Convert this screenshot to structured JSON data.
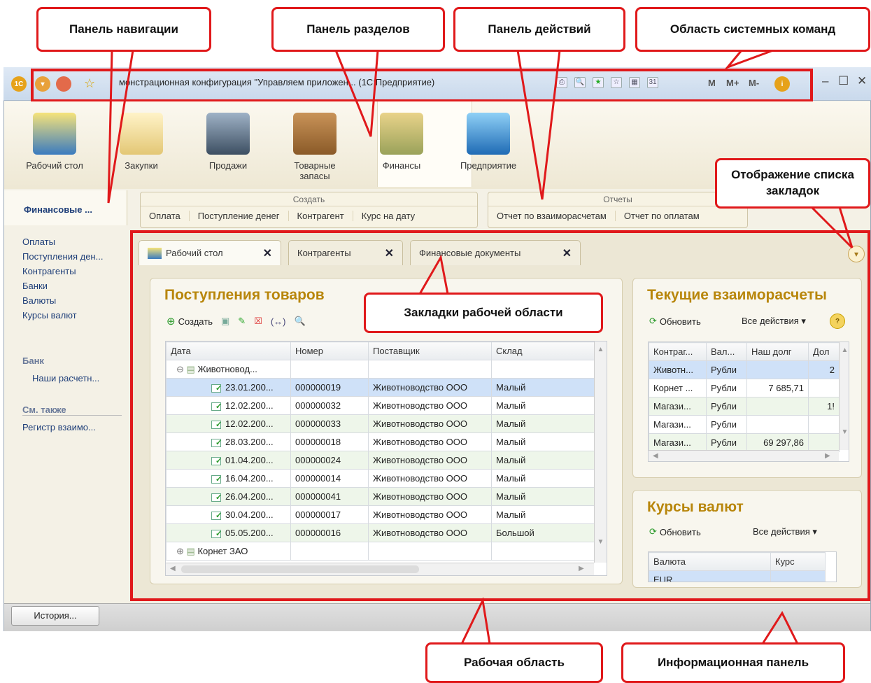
{
  "callouts": {
    "nav_panel": "Панель навигации",
    "sections_panel": "Панель разделов",
    "actions_panel": "Панель действий",
    "system_commands": "Область системных команд",
    "bookmarks_list": "Отображение списка закладок",
    "tabs_area": "Закладки рабочей области",
    "work_area": "Рабочая область",
    "info_panel": "Информационная панель"
  },
  "window": {
    "title": "монстрационная конфигурация \"Управляем  приложен... (1С:Предприятие)",
    "calc_buttons": [
      "M",
      "M+",
      "M-"
    ],
    "win_controls": [
      "–",
      "☐",
      "✕"
    ]
  },
  "sections": [
    {
      "label": "Рабочий стол",
      "icon": "desk-lamp-icon"
    },
    {
      "label": "Закупки",
      "icon": "shopping-bag-icon"
    },
    {
      "label": "Продажи",
      "icon": "cash-register-icon"
    },
    {
      "label": "Товарные запасы",
      "icon": "box-icon"
    },
    {
      "label": "Финансы",
      "icon": "coins-icon"
    },
    {
      "label": "Предприятие",
      "icon": "building-icon"
    }
  ],
  "actions": {
    "create_group": {
      "title": "Создать",
      "items": [
        "Оплата",
        "Поступление денег",
        "Контрагент",
        "Курс на дату"
      ]
    },
    "reports_group": {
      "title": "Отчеты",
      "items": [
        "Отчет по взаиморасчетам",
        "Отчет по оплатам"
      ]
    }
  },
  "nav": {
    "header": "Финансовые ...",
    "links": [
      "Оплаты",
      "Поступления ден...",
      "Контрагенты",
      "Банки",
      "Валюты",
      "Курсы валют"
    ],
    "bank_header": "Банк",
    "bank_links": [
      "Наши расчетн..."
    ],
    "see_also_header": "См. также",
    "see_also_links": [
      "Регистр взаимо..."
    ]
  },
  "tabs": [
    "Рабочий стол",
    "Контрагенты",
    "Финансовые документы"
  ],
  "receipts": {
    "title": "Поступления товаров",
    "create_label": "Создать",
    "columns": [
      "Дата",
      "Номер",
      "Поставщик",
      "Склад"
    ],
    "group_row": "Животновод...",
    "rows": [
      {
        "date": "23.01.200...",
        "number": "000000019",
        "supplier": "Животноводство ООО",
        "stock": "Малый"
      },
      {
        "date": "12.02.200...",
        "number": "000000032",
        "supplier": "Животноводство ООО",
        "stock": "Малый"
      },
      {
        "date": "12.02.200...",
        "number": "000000033",
        "supplier": "Животноводство ООО",
        "stock": "Малый"
      },
      {
        "date": "28.03.200...",
        "number": "000000018",
        "supplier": "Животноводство ООО",
        "stock": "Малый"
      },
      {
        "date": "01.04.200...",
        "number": "000000024",
        "supplier": "Животноводство ООО",
        "stock": "Малый"
      },
      {
        "date": "16.04.200...",
        "number": "000000014",
        "supplier": "Животноводство ООО",
        "stock": "Малый"
      },
      {
        "date": "26.04.200...",
        "number": "000000041",
        "supplier": "Животноводство ООО",
        "stock": "Малый"
      },
      {
        "date": "30.04.200...",
        "number": "000000017",
        "supplier": "Животноводство ООО",
        "stock": "Малый"
      },
      {
        "date": "05.05.200...",
        "number": "000000016",
        "supplier": "Животноводство ООО",
        "stock": "Большой"
      }
    ],
    "group_row2": "Корнет ЗАО"
  },
  "settlements": {
    "title": "Текущие взаиморасчеты",
    "refresh": "Обновить",
    "all_actions": "Все действия ▾",
    "columns": [
      "Контраг...",
      "Вал...",
      "Наш долг",
      "Дол"
    ],
    "rows": [
      [
        "Животн...",
        "Рубли",
        "",
        "2"
      ],
      [
        "Корнет ...",
        "Рубли",
        "7 685,71",
        ""
      ],
      [
        "Магази...",
        "Рубли",
        "",
        "1!"
      ],
      [
        "Магази...",
        "Рубли",
        "",
        ""
      ],
      [
        "Магази...",
        "Рубли",
        "69 297,86",
        ""
      ]
    ]
  },
  "rates": {
    "title": "Курсы валют",
    "refresh": "Обновить",
    "all_actions": "Все действия ▾",
    "columns": [
      "Валюта",
      "Курс"
    ],
    "rows": [
      [
        "EUR",
        ""
      ]
    ]
  },
  "history_button": "История..."
}
